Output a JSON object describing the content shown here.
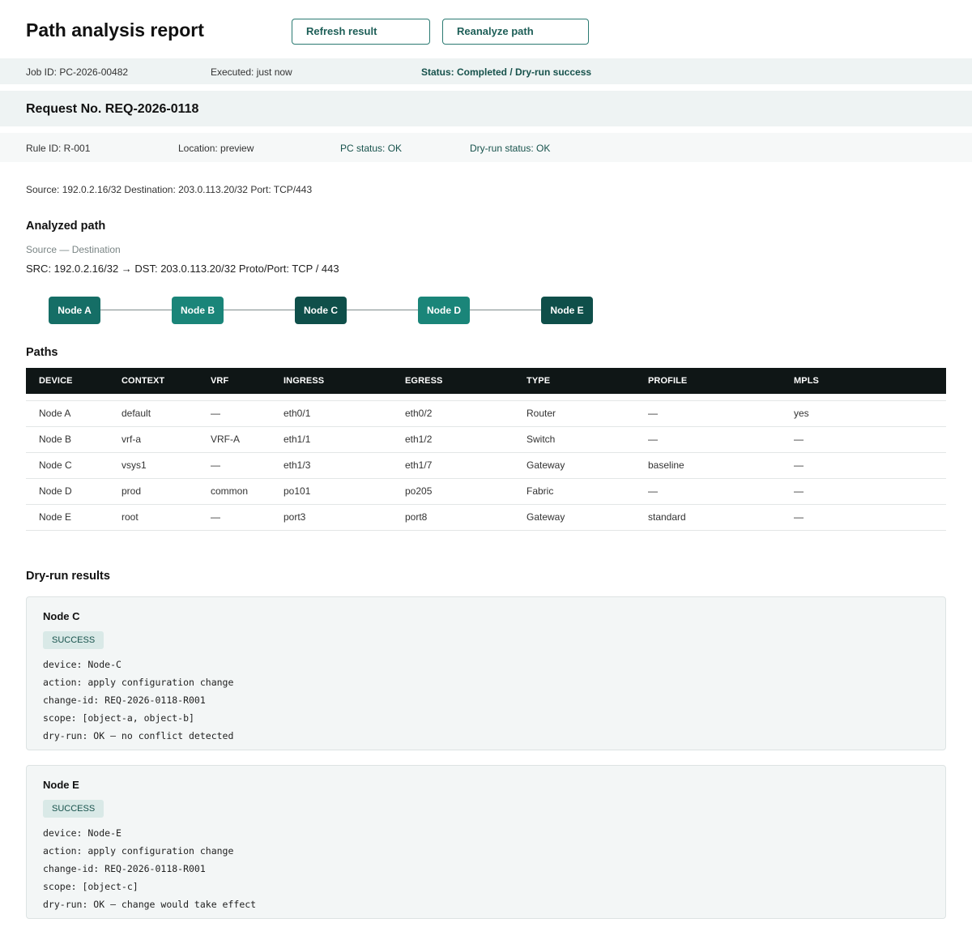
{
  "header": {
    "title": "Path analysis report",
    "refresh_label": "Refresh result",
    "reanalyze_label": "Reanalyze path"
  },
  "job": {
    "id": "Job ID: PC-2026-00482",
    "executed": "Executed: just now",
    "status": "Status: Completed / Dry-run success"
  },
  "request": {
    "title": "Request No. REQ-2026-0118"
  },
  "rule": {
    "rule_id": "Rule ID: R-001",
    "location": "Location: preview",
    "pc_status": "PC status: OK",
    "dryrun_status": "Dry-run status: OK"
  },
  "summary": "Source: 192.0.2.16/32 Destination: 203.0.113.20/32 Port: TCP/443",
  "analyzed_path": {
    "title": "Analyzed path",
    "subtitle": "Source — Destination",
    "line": "SRC: 192.0.2.16/32 → DST: 203.0.113.20/32 Proto/Port: TCP / 443",
    "nodes": [
      "Node A",
      "Node B",
      "Node C",
      "Node D",
      "Node E"
    ]
  },
  "paths": {
    "title": "Paths",
    "columns": [
      "DEVICE",
      "CONTEXT",
      "VRF",
      "INGRESS",
      "EGRESS",
      "TYPE",
      "PROFILE",
      "MPLS"
    ],
    "rows": [
      [
        "Node A",
        "default",
        "—",
        "eth0/1",
        "eth0/2",
        "Router",
        "—",
        "yes"
      ],
      [
        "Node B",
        "vrf-a",
        "VRF-A",
        "eth1/1",
        "eth1/2",
        "Switch",
        "—",
        "—"
      ],
      [
        "Node C",
        "vsys1",
        "—",
        "eth1/3",
        "eth1/7",
        "Gateway",
        "baseline",
        "—"
      ],
      [
        "Node D",
        "prod",
        "common",
        "po101",
        "po205",
        "Fabric",
        "—",
        "—"
      ],
      [
        "Node E",
        "root",
        "—",
        "port3",
        "port8",
        "Gateway",
        "standard",
        "—"
      ]
    ]
  },
  "dryrun": {
    "title": "Dry-run results",
    "cards": [
      {
        "title": "Node C",
        "badge": "SUCCESS",
        "lines": [
          "device: Node-C",
          "action: apply configuration change",
          "change-id: REQ-2026-0118-R001",
          "scope: [object-a, object-b]",
          "dry-run: OK — no conflict detected"
        ]
      },
      {
        "title": "Node E",
        "badge": "SUCCESS",
        "lines": [
          "device: Node-E",
          "action: apply configuration change",
          "change-id: REQ-2026-0118-R001",
          "scope: [object-c]",
          "dry-run: OK — change would take effect"
        ]
      }
    ]
  },
  "colors": {
    "accent": "#1d5e57",
    "node_dark": "#0f4f4a",
    "node_teal": "#1a8579",
    "table_header": "#0f1616",
    "badge_bg": "#d9e9e7"
  }
}
